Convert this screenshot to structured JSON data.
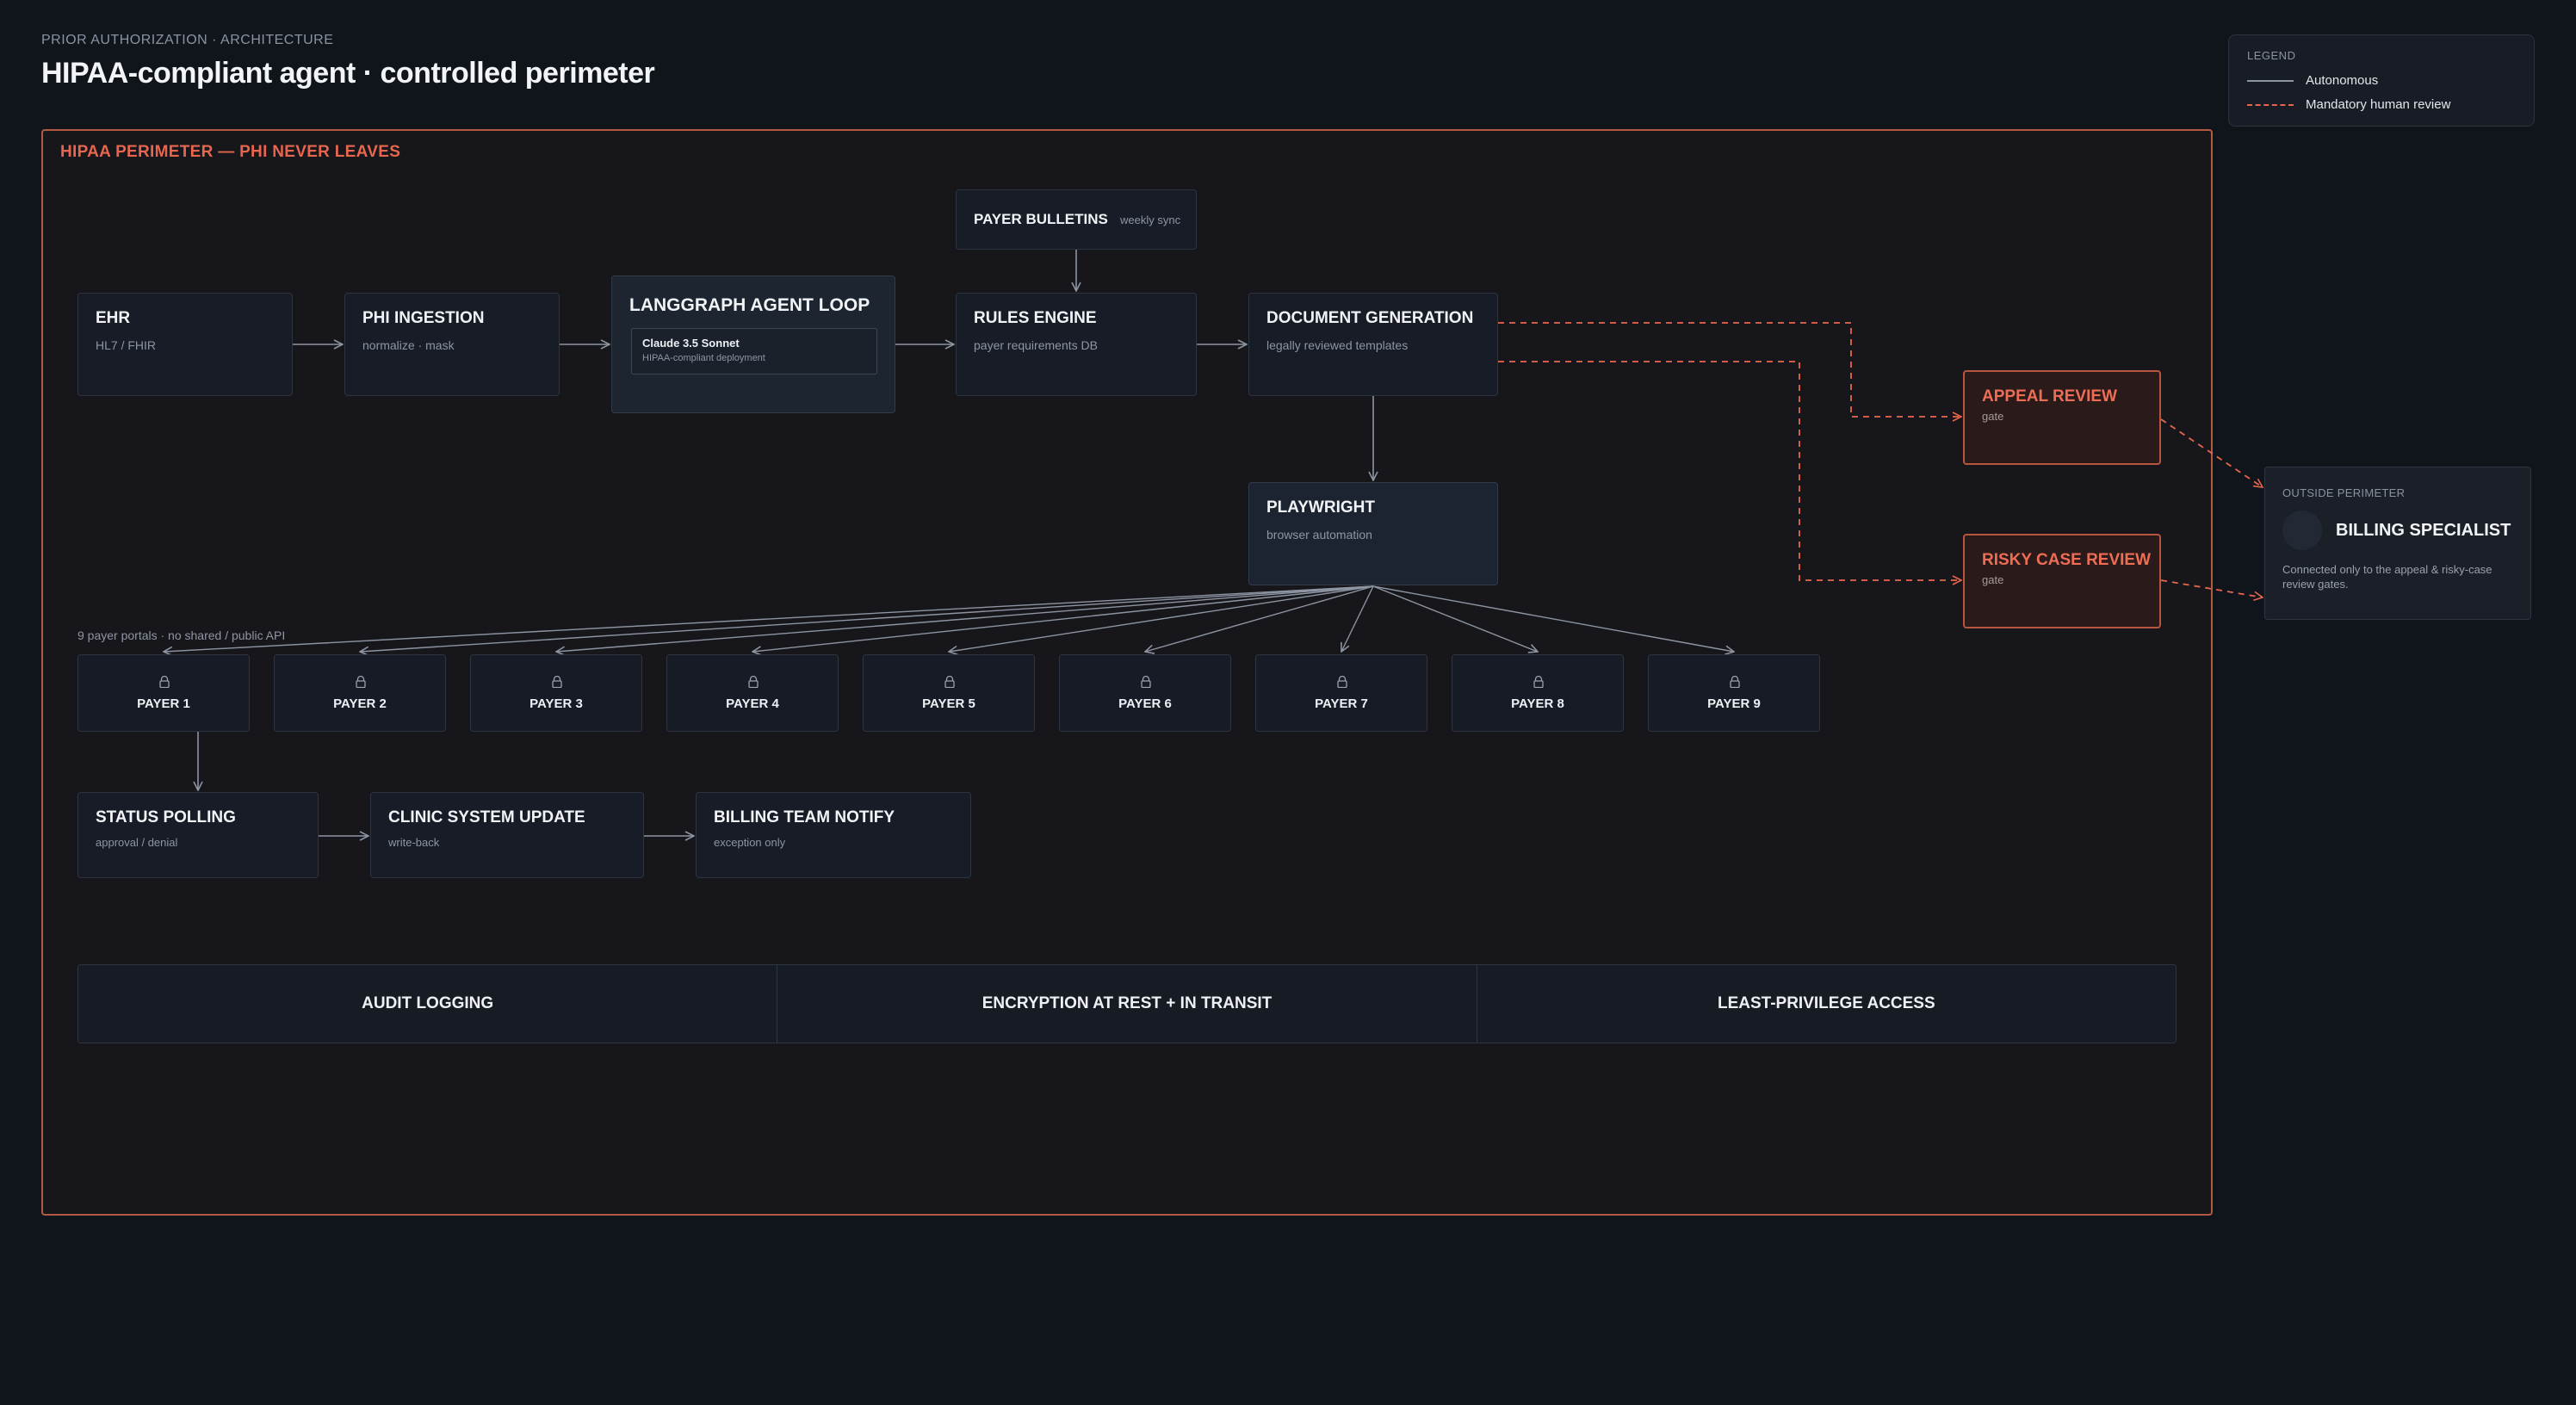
{
  "header": {
    "eyebrow": "PRIOR AUTHORIZATION · ARCHITECTURE",
    "title": "HIPAA-compliant agent · controlled perimeter"
  },
  "legend": {
    "title": "LEGEND",
    "autonomous": "Autonomous",
    "human_review": "Mandatory human review"
  },
  "perimeter": {
    "label": "HIPAA PERIMETER — PHI NEVER LEAVES"
  },
  "nodes": {
    "payer_bulletins": {
      "title": "PAYER BULLETINS",
      "sub": "weekly sync"
    },
    "ehr": {
      "title": "EHR",
      "sub": "HL7 / FHIR"
    },
    "phi_ingestion": {
      "title": "PHI INGESTION",
      "sub": "normalize · mask"
    },
    "agent_loop": {
      "title": "LANGGRAPH AGENT LOOP",
      "model": "Claude 3.5 Sonnet",
      "model_sub": "HIPAA-compliant deployment"
    },
    "rules_engine": {
      "title": "RULES ENGINE",
      "sub": "payer requirements DB"
    },
    "doc_gen": {
      "title": "DOCUMENT GENERATION",
      "sub": "legally reviewed templates"
    },
    "playwright": {
      "title": "PLAYWRIGHT",
      "sub": "browser automation"
    },
    "appeal_review": {
      "title": "APPEAL REVIEW",
      "sub": "gate"
    },
    "risky_review": {
      "title": "RISKY CASE REVIEW",
      "sub": "gate"
    },
    "status_polling": {
      "title": "STATUS POLLING",
      "sub": "approval / denial"
    },
    "clinic_update": {
      "title": "CLINIC SYSTEM UPDATE",
      "sub": "write-back"
    },
    "billing_notify": {
      "title": "BILLING TEAM NOTIFY",
      "sub": "exception only"
    }
  },
  "portals_label": "9 payer portals · no shared / public API",
  "payers": [
    "PAYER 1",
    "PAYER 2",
    "PAYER 3",
    "PAYER 4",
    "PAYER 5",
    "PAYER 6",
    "PAYER 7",
    "PAYER 8",
    "PAYER 9"
  ],
  "bottom_bar": [
    "AUDIT LOGGING",
    "ENCRYPTION AT REST + IN TRANSIT",
    "LEAST-PRIVILEGE ACCESS"
  ],
  "outside": {
    "label": "OUTSIDE PERIMETER",
    "name": "BILLING SPECIALIST",
    "desc": "Connected only to the appeal & risky-case review gates."
  },
  "colors": {
    "background": "#10141b",
    "perimeter": "#b45a44",
    "accent": "#e8664e",
    "arrow": "#8d95a3"
  },
  "icons": {
    "payer": "lock-icon"
  }
}
